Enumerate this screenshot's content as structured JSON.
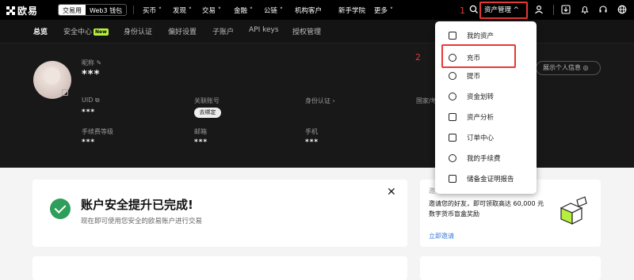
{
  "logo": {
    "text": "欧易"
  },
  "mode_toggle": {
    "exchange": "交易用",
    "web3": "Web3 钱包"
  },
  "nav": [
    "买币",
    "发现",
    "交易",
    "金融",
    "公链",
    "机构客户",
    "新手学院",
    "更多"
  ],
  "header": {
    "asset_management": "资产管理"
  },
  "annotations": {
    "step1": "1",
    "step2": "2"
  },
  "subnav": [
    {
      "label": "总览",
      "active": true
    },
    {
      "label": "安全中心",
      "badge": "New"
    },
    {
      "label": "身份认证"
    },
    {
      "label": "偏好设置"
    },
    {
      "label": "子账户"
    },
    {
      "label": "API keys"
    },
    {
      "label": "授权管理"
    }
  ],
  "profile": {
    "nickname_label": "昵称",
    "nickname_value": "***",
    "show_info": "展示个人信息",
    "fields": [
      {
        "label": "UID",
        "value": "***"
      },
      {
        "label": "关联账号",
        "button": "去绑定"
      },
      {
        "label": "身份认证"
      },
      {
        "label": "国家/地"
      },
      {
        "label": "手续费等级",
        "value": "***"
      },
      {
        "label": "邮箱",
        "value": "***"
      },
      {
        "label": "手机",
        "value": "***"
      }
    ]
  },
  "dropdown": [
    {
      "label": "我的资产",
      "icon": "wallet-icon"
    },
    {
      "label": "充币",
      "icon": "deposit-icon"
    },
    {
      "label": "提币",
      "icon": "withdraw-icon"
    },
    {
      "label": "资金划转",
      "icon": "transfer-icon"
    },
    {
      "label": "资产分析",
      "icon": "analysis-icon"
    },
    {
      "label": "订单中心",
      "icon": "order-icon"
    },
    {
      "label": "我的手续费",
      "icon": "fee-icon"
    },
    {
      "label": "储备金证明报告",
      "icon": "reserve-report-icon"
    }
  ],
  "security_card": {
    "title": "账户安全提升已完成!",
    "subtitle": "现在即可使用您安全的欧易账户进行交易"
  },
  "invite_card": {
    "top": "邀请",
    "text": "邀请您的好友，即可领取高达 60,000 元数字货币盲盒奖励",
    "link": "立即邀请"
  },
  "colors": {
    "accent_red": "#e53935",
    "success_green": "#2e9e5b",
    "link_blue": "#3a7bd5",
    "badge_lime": "#b7f03c"
  }
}
